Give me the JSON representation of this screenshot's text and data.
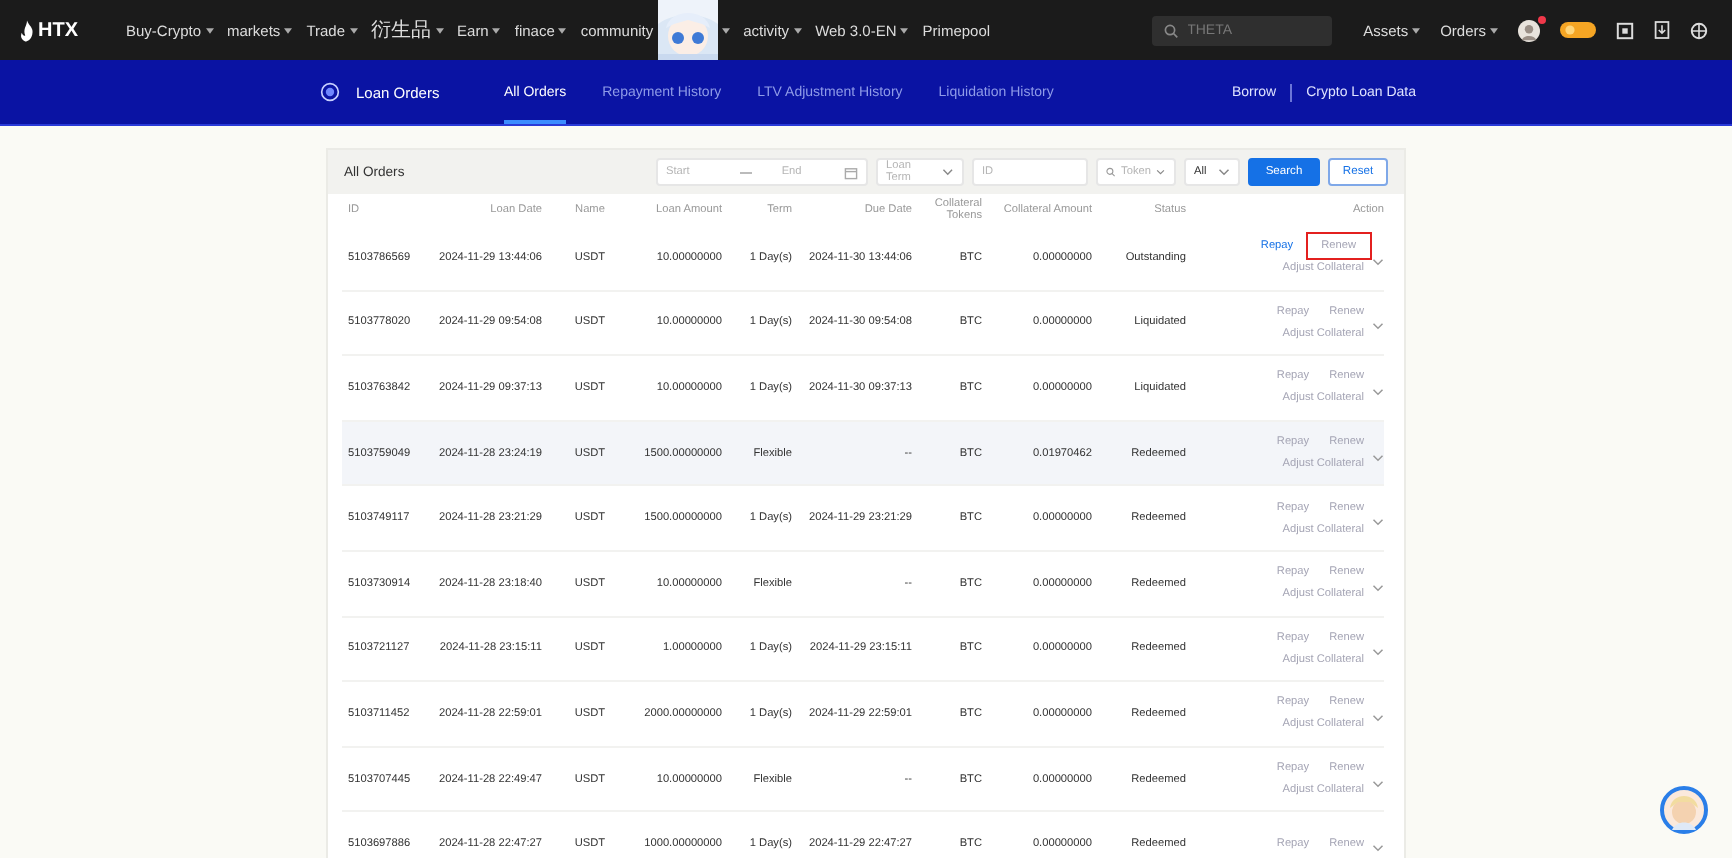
{
  "topbar": {
    "logo": "HTX",
    "nav": [
      {
        "label": "Buy-Crypto",
        "caret": true
      },
      {
        "label": "markets",
        "caret": true
      },
      {
        "label": "Trade",
        "caret": true
      },
      {
        "label": "衍生品",
        "caret": true
      },
      {
        "label": "Earn",
        "caret": true
      },
      {
        "label": "finace",
        "caret": true
      },
      {
        "label": "community",
        "caret": false,
        "kind": "picture"
      },
      {
        "label": "activity",
        "caret": true
      },
      {
        "label": "Web 3.0-EN",
        "caret": true
      },
      {
        "label": "Primepool",
        "caret": false
      }
    ],
    "search": {
      "placeholder": "THETA"
    },
    "menus": [
      {
        "label": "Assets"
      },
      {
        "label": "Orders"
      }
    ],
    "notification_dot": true
  },
  "subnav": {
    "title": "Loan Orders",
    "tabs": [
      {
        "label": "All Orders",
        "selected": true
      },
      {
        "label": "Repayment History",
        "selected": false
      },
      {
        "label": "LTV Adjustment History",
        "selected": false
      },
      {
        "label": "Liquidation History",
        "selected": false
      }
    ],
    "links": [
      "Borrow",
      "Crypto Loan Data"
    ]
  },
  "panel": {
    "title": "All Orders",
    "filters": {
      "start": "Start",
      "end": "End",
      "loan_term": "Loan Term",
      "id": "ID",
      "token": "Token",
      "status": "All"
    },
    "buttons": [
      "Search",
      "Reset"
    ],
    "columns": [
      "ID",
      "Loan Date",
      "Name",
      "Loan Amount",
      "Term",
      "Due Date",
      "Collateral Tokens",
      "Collateral Amount",
      "Status",
      "Action"
    ],
    "rows": [
      {
        "id": "5103786569",
        "loan_date": "2024-11-29 13:44:06",
        "name": "USDT",
        "loan_amount": "10.00000000",
        "term": "1 Day(s)",
        "due_date": "2024-11-30 13:44:06",
        "collateral_token": "BTC",
        "collateral_amount": "0.00000000",
        "status": "Outstanding",
        "highlighted": false,
        "actions": [
          {
            "label": "Repay",
            "enabled": true,
            "outlined": false
          },
          {
            "label": "Renew",
            "enabled": false,
            "outlined": true
          }
        ],
        "adjust": "Adjust Collateral"
      },
      {
        "id": "5103778020",
        "loan_date": "2024-11-29 09:54:08",
        "name": "USDT",
        "loan_amount": "10.00000000",
        "term": "1 Day(s)",
        "due_date": "2024-11-30 09:54:08",
        "collateral_token": "BTC",
        "collateral_amount": "0.00000000",
        "status": "Liquidated",
        "highlighted": false,
        "actions": [
          {
            "label": "Repay",
            "enabled": false,
            "outlined": false
          },
          {
            "label": "Renew",
            "enabled": false,
            "outlined": false
          }
        ],
        "adjust": "Adjust Collateral"
      },
      {
        "id": "5103763842",
        "loan_date": "2024-11-29 09:37:13",
        "name": "USDT",
        "loan_amount": "10.00000000",
        "term": "1 Day(s)",
        "due_date": "2024-11-30 09:37:13",
        "collateral_token": "BTC",
        "collateral_amount": "0.00000000",
        "status": "Liquidated",
        "highlighted": false,
        "actions": [
          {
            "label": "Repay",
            "enabled": false,
            "outlined": false
          },
          {
            "label": "Renew",
            "enabled": false,
            "outlined": false
          }
        ],
        "adjust": "Adjust Collateral"
      },
      {
        "id": "5103759049",
        "loan_date": "2024-11-28 23:24:19",
        "name": "USDT",
        "loan_amount": "1500.00000000",
        "term": "Flexible",
        "due_date": "--",
        "collateral_token": "BTC",
        "collateral_amount": "0.01970462",
        "status": "Redeemed",
        "highlighted": true,
        "actions": [
          {
            "label": "Repay",
            "enabled": false,
            "outlined": false
          },
          {
            "label": "Renew",
            "enabled": false,
            "outlined": false
          }
        ],
        "adjust": "Adjust Collateral"
      },
      {
        "id": "5103749117",
        "loan_date": "2024-11-28 23:21:29",
        "name": "USDT",
        "loan_amount": "1500.00000000",
        "term": "1 Day(s)",
        "due_date": "2024-11-29 23:21:29",
        "collateral_token": "BTC",
        "collateral_amount": "0.00000000",
        "status": "Redeemed",
        "highlighted": false,
        "actions": [
          {
            "label": "Repay",
            "enabled": false,
            "outlined": false
          },
          {
            "label": "Renew",
            "enabled": false,
            "outlined": false
          }
        ],
        "adjust": "Adjust Collateral"
      },
      {
        "id": "5103730914",
        "loan_date": "2024-11-28 23:18:40",
        "name": "USDT",
        "loan_amount": "10.00000000",
        "term": "Flexible",
        "due_date": "--",
        "collateral_token": "BTC",
        "collateral_amount": "0.00000000",
        "status": "Redeemed",
        "highlighted": false,
        "actions": [
          {
            "label": "Repay",
            "enabled": false,
            "outlined": false
          },
          {
            "label": "Renew",
            "enabled": false,
            "outlined": false
          }
        ],
        "adjust": "Adjust Collateral"
      },
      {
        "id": "5103721127",
        "loan_date": "2024-11-28 23:15:11",
        "name": "USDT",
        "loan_amount": "1.00000000",
        "term": "1 Day(s)",
        "due_date": "2024-11-29 23:15:11",
        "collateral_token": "BTC",
        "collateral_amount": "0.00000000",
        "status": "Redeemed",
        "highlighted": false,
        "actions": [
          {
            "label": "Repay",
            "enabled": false,
            "outlined": false
          },
          {
            "label": "Renew",
            "enabled": false,
            "outlined": false
          }
        ],
        "adjust": "Adjust Collateral"
      },
      {
        "id": "5103711452",
        "loan_date": "2024-11-28 22:59:01",
        "name": "USDT",
        "loan_amount": "2000.00000000",
        "term": "1 Day(s)",
        "due_date": "2024-11-29 22:59:01",
        "collateral_token": "BTC",
        "collateral_amount": "0.00000000",
        "status": "Redeemed",
        "highlighted": false,
        "actions": [
          {
            "label": "Repay",
            "enabled": false,
            "outlined": false
          },
          {
            "label": "Renew",
            "enabled": false,
            "outlined": false
          }
        ],
        "adjust": "Adjust Collateral"
      },
      {
        "id": "5103707445",
        "loan_date": "2024-11-28 22:49:47",
        "name": "USDT",
        "loan_amount": "10.00000000",
        "term": "Flexible",
        "due_date": "--",
        "collateral_token": "BTC",
        "collateral_amount": "0.00000000",
        "status": "Redeemed",
        "highlighted": false,
        "actions": [
          {
            "label": "Repay",
            "enabled": false,
            "outlined": false
          },
          {
            "label": "Renew",
            "enabled": false,
            "outlined": false
          }
        ],
        "adjust": "Adjust Collateral"
      },
      {
        "id": "5103697886",
        "loan_date": "2024-11-28 22:47:27",
        "name": "USDT",
        "loan_amount": "1000.00000000",
        "term": "1 Day(s)",
        "due_date": "2024-11-29 22:47:27",
        "collateral_token": "BTC",
        "collateral_amount": "0.00000000",
        "status": "Redeemed",
        "highlighted": false,
        "actions": [
          {
            "label": "Repay",
            "enabled": false,
            "outlined": false
          },
          {
            "label": "Renew",
            "enabled": false,
            "outlined": false
          }
        ]
      }
    ]
  }
}
